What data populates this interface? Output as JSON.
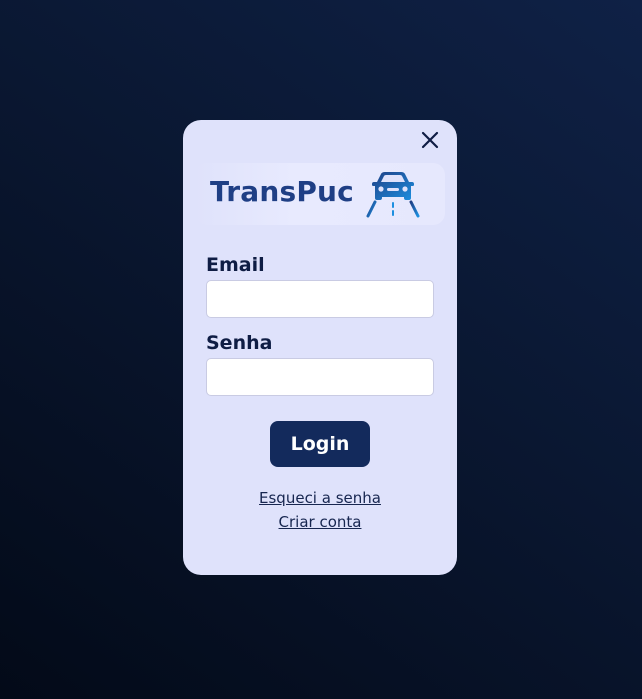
{
  "colors": {
    "background_top": "#0f2146",
    "background_bottom": "#030a18",
    "modal": "#dfe2fb",
    "brand": "#1f3f85",
    "button": "#132a5c",
    "link": "#172650"
  },
  "modal": {
    "close_icon": "close-icon",
    "logo": {
      "text": "TransPuc",
      "icon": "car-road-icon"
    },
    "email": {
      "label": "Email",
      "value": "",
      "placeholder": ""
    },
    "password": {
      "label": "Senha",
      "value": "",
      "placeholder": ""
    },
    "login_button": "Login",
    "forgot_password_link": "Esqueci a senha",
    "create_account_link": "Criar conta"
  }
}
